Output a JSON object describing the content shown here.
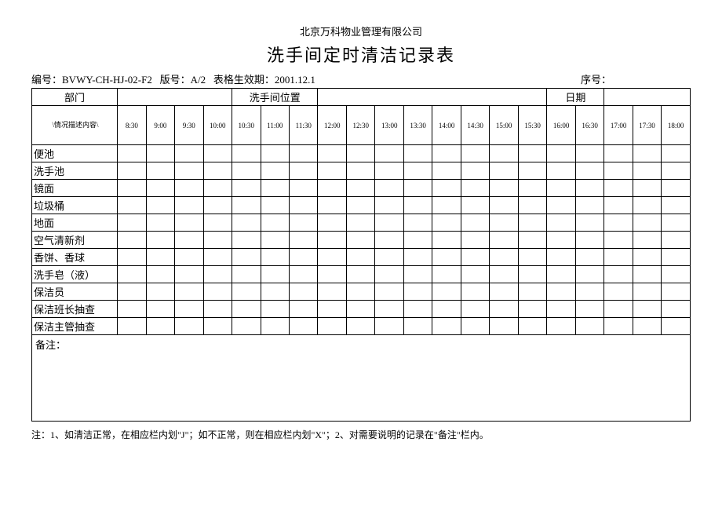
{
  "company": "北京万科物业管理有限公司",
  "title": "洗手间定时清洁记录表",
  "meta": {
    "code_label": "编号：",
    "code": "BVWY-CH-HJ-02-F2",
    "version_label": "版号：",
    "version": "A/2",
    "effective_label": "表格生效期：",
    "effective": "2001.12.1",
    "seq_label": "序号："
  },
  "header": {
    "department": "部门",
    "location": "洗手间位置",
    "date": "日期"
  },
  "desc_label": "\\情况描述内容\\",
  "times": [
    "8:30",
    "9:00",
    "9:30",
    "10:00",
    "10:30",
    "11:00",
    "11:30",
    "12:00",
    "12:30",
    "13:00",
    "13:30",
    "14:00",
    "14:30",
    "15:00",
    "15:30",
    "16:00",
    "16:30",
    "17:00",
    "17:30",
    "18:00"
  ],
  "rows": [
    "便池",
    "洗手池",
    "镜面",
    "垃圾桶",
    "地面",
    "空气清新剂",
    "香饼、香球",
    "洗手皂（液）",
    "保洁员",
    "保洁班长抽查",
    "保洁主管抽查"
  ],
  "remarks_label": "备注：",
  "footnote": "注：1、如清洁正常，在相应栏内划\"J\"；如不正常，则在相应栏内划\"X\"；2、对需要说明的记录在\"备注\"栏内。"
}
